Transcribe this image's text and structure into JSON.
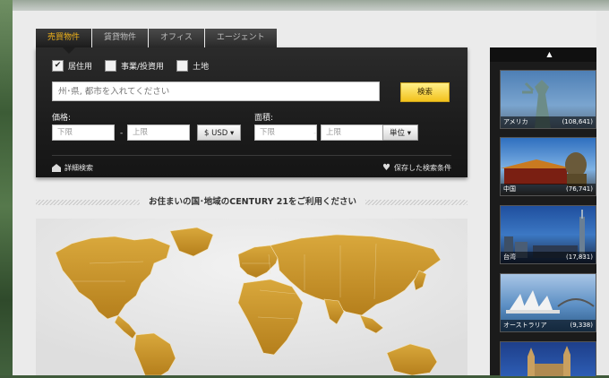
{
  "tabs": [
    {
      "label": "売買物件",
      "active": true
    },
    {
      "label": "賃貸物件",
      "active": false
    },
    {
      "label": "オフィス",
      "active": false
    },
    {
      "label": "エージェント",
      "active": false
    }
  ],
  "search": {
    "property_types": [
      {
        "label": "居住用",
        "checked": true
      },
      {
        "label": "事業/投資用",
        "checked": false
      },
      {
        "label": "土地",
        "checked": false
      }
    ],
    "location_placeholder": "州･県, 都市を入れてください",
    "search_button": "検索",
    "price_label": "価格:",
    "price_min_placeholder": "下限",
    "price_max_placeholder": "上限",
    "range_separator": "-",
    "currency": "$ USD",
    "area_label": "面積:",
    "area_min_placeholder": "下限",
    "area_max_placeholder": "上限",
    "unit": "単位",
    "advanced_search": "詳細検索",
    "saved_searches": "保存した検索条件"
  },
  "map_heading": "お住まいの国･地域のCENTURY 21をご利用ください",
  "rail": {
    "up_arrow": "▲",
    "countries": [
      {
        "name": "アメリカ",
        "count": "(108,641)"
      },
      {
        "name": "中国",
        "count": "(76,741)"
      },
      {
        "name": "台湾",
        "count": "(17,831)"
      },
      {
        "name": "オーストラリア",
        "count": "(9,338)"
      }
    ]
  },
  "colors": {
    "accent": "#f0b21a",
    "panel": "#1c1c1c",
    "map_gold": "#c8962a"
  }
}
